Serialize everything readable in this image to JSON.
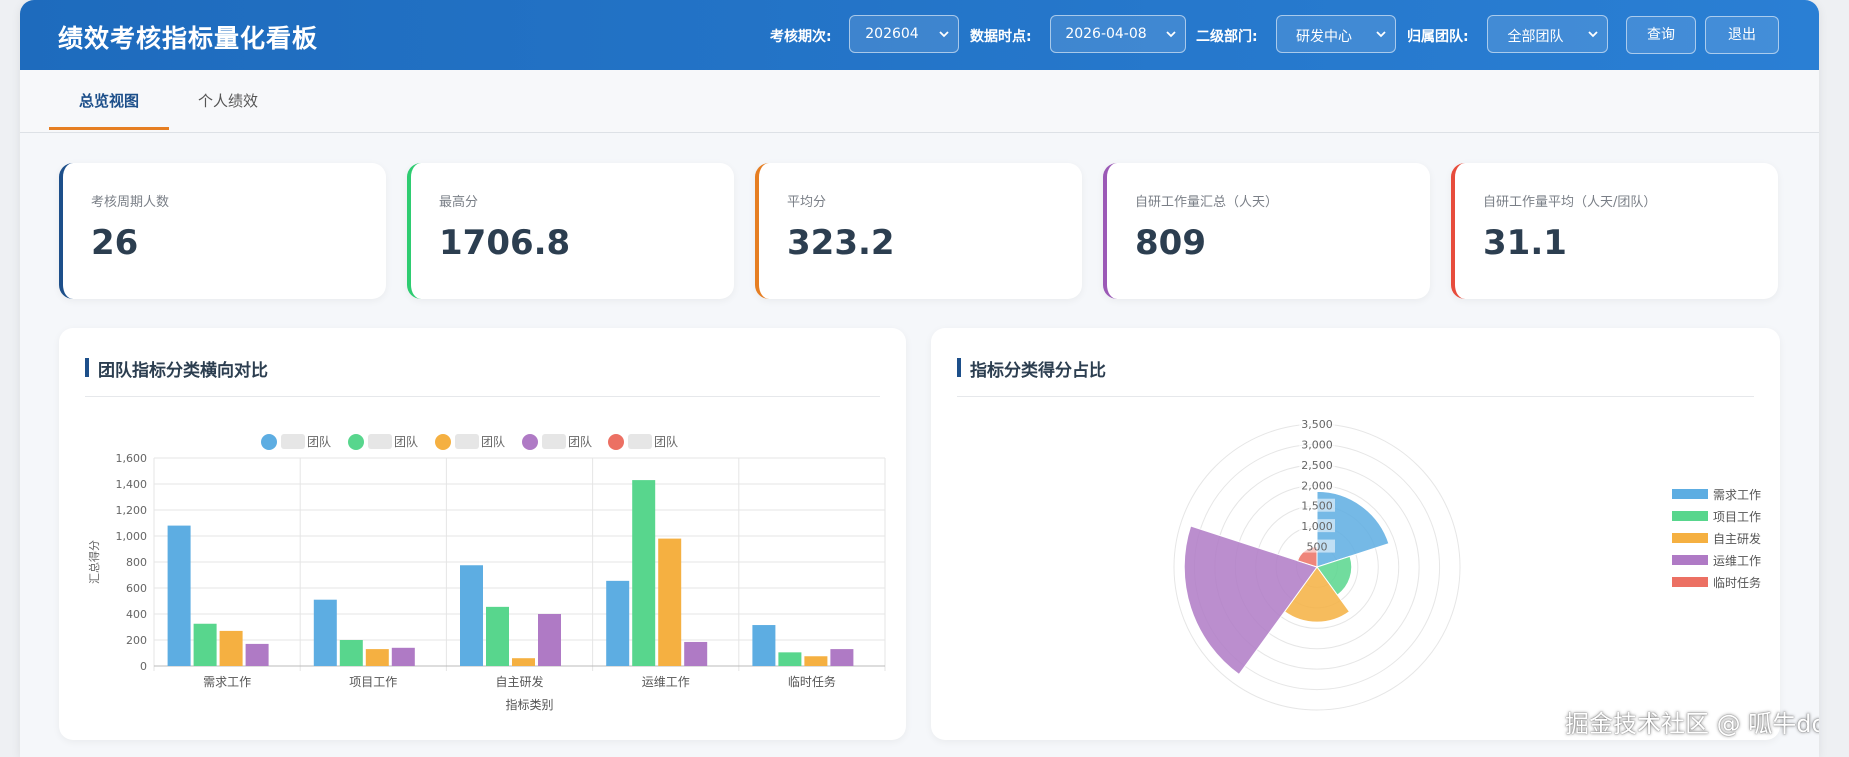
{
  "header": {
    "title": "绩效考核指标量化看板",
    "filters": [
      {
        "label": "考核期次:",
        "value": "202604"
      },
      {
        "label": "数据时点:",
        "value": "2026-04-08"
      },
      {
        "label": "二级部门:",
        "value": "研发中心"
      },
      {
        "label": "归属团队:",
        "value": "全部团队"
      }
    ],
    "query_label": "查询",
    "logout_label": "退出"
  },
  "tabs": [
    {
      "label": "总览视图",
      "active": true
    },
    {
      "label": "个人绩效",
      "active": false
    }
  ],
  "kpis": [
    {
      "label": "考核周期人数",
      "value": "26",
      "accent": "#1d4f8a"
    },
    {
      "label": "最高分",
      "value": "1706.8",
      "accent": "#2ecc71"
    },
    {
      "label": "平均分",
      "value": "323.2",
      "accent": "#e67e22"
    },
    {
      "label": "自研工作量汇总（人天）",
      "value": "809",
      "accent": "#9b59b6"
    },
    {
      "label": "自研工作量平均（人天/团队）",
      "value": "31.1",
      "accent": "#e74c3c"
    }
  ],
  "panels": {
    "bar": {
      "title": "团队指标分类横向对比"
    },
    "polar": {
      "title": "指标分类得分占比"
    }
  },
  "chart_data": [
    {
      "type": "bar",
      "title": "团队指标分类横向对比",
      "xlabel": "指标类别",
      "ylabel": "汇总得分",
      "categories": [
        "需求工作",
        "项目工作",
        "自主研发",
        "运维工作",
        "临时任务"
      ],
      "series": [
        {
          "name": "团队",
          "color": "#5dade2",
          "values": [
            1080,
            510,
            775,
            655,
            315
          ]
        },
        {
          "name": "团队",
          "color": "#58d68d",
          "values": [
            325,
            200,
            455,
            1430,
            105
          ]
        },
        {
          "name": "团队",
          "color": "#f5b041",
          "values": [
            270,
            130,
            60,
            980,
            75
          ]
        },
        {
          "name": "团队",
          "color": "#af7ac5",
          "values": [
            170,
            140,
            400,
            185,
            130
          ]
        },
        {
          "name": "团队",
          "color": "#ec7063",
          "values": [
            0,
            0,
            0,
            0,
            0
          ]
        }
      ],
      "ylim": [
        0,
        1600
      ],
      "yticks": [
        0,
        200,
        400,
        600,
        800,
        1000,
        1200,
        1400,
        1600
      ],
      "ytick_labels": [
        "0",
        "200",
        "400",
        "600",
        "800",
        "1,000",
        "1,200",
        "1,400",
        "1,600"
      ],
      "grid": true,
      "legend": "top-center"
    },
    {
      "type": "polarArea",
      "title": "指标分类得分占比",
      "categories": [
        "需求工作",
        "项目工作",
        "自主研发",
        "运维工作",
        "临时任务"
      ],
      "values": [
        1850,
        850,
        1350,
        3250,
        500
      ],
      "colors": [
        "#5dade2",
        "#58d68d",
        "#f5b041",
        "#af7ac5",
        "#ec7063"
      ],
      "rlim": [
        0,
        3500
      ],
      "rticks": [
        500,
        1000,
        1500,
        2000,
        2500,
        3000,
        3500
      ],
      "rtick_labels": [
        "500",
        "1,000",
        "1,500",
        "2,000",
        "2,500",
        "3,000",
        "3,500"
      ],
      "legend": "right"
    }
  ],
  "watermark": "掘金技术社区 @ 呱牛doit"
}
